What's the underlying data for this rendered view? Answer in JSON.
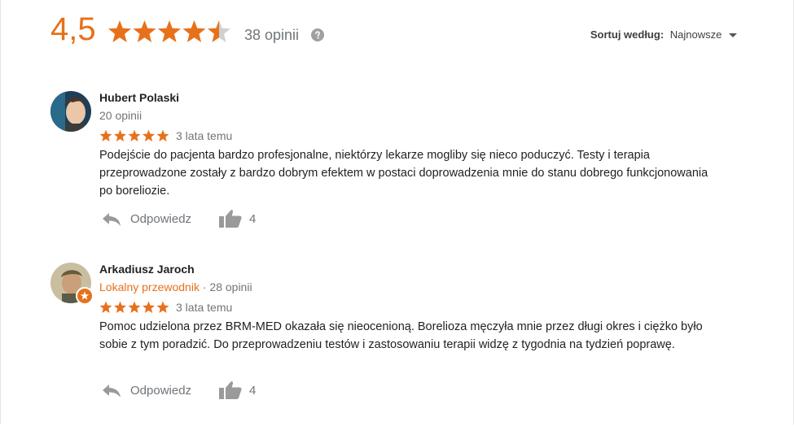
{
  "summary": {
    "rating": "4,5",
    "rating_value": 4.5,
    "rating_max": 5,
    "count": "38 opinii",
    "help_icon": "question-circle-icon",
    "star_color": "#e7711b"
  },
  "sort": {
    "label": "Sortuj według:",
    "value": "Najnowsze"
  },
  "reviews": [
    {
      "name": "Hubert Polaski",
      "meta": "20 opinii",
      "rating": 5,
      "date": "3 lata temu",
      "text": "Podejście do pacjenta bardzo profesjonalne, niektórzy lekarze mogliby się nieco poduczyć. Testy i terapia przeprowadzone zostały z bardzo dobrym efektem w postaci doprowadzenia mnie do stanu dobrego funkcjonowania po boreliozie.",
      "reply_label": "Odpowiedz",
      "likes": "4"
    },
    {
      "name": "Arkadiusz Jaroch",
      "guide": "Lokalny przewodnik",
      "meta": " · 28 opinii",
      "rating": 5,
      "date": "3 lata temu",
      "text": "Pomoc udzielona przez BRM-MED okazała się nieocenioną. Borelioza męczyła mnie przez długi okres i ciężko było sobie z tym poradzić. Do przeprowadzeniu testów i zastosowaniu terapii widzę z tygodnia na tydzień poprawę.",
      "reply_label": "Odpowiedz",
      "likes": "4"
    }
  ]
}
